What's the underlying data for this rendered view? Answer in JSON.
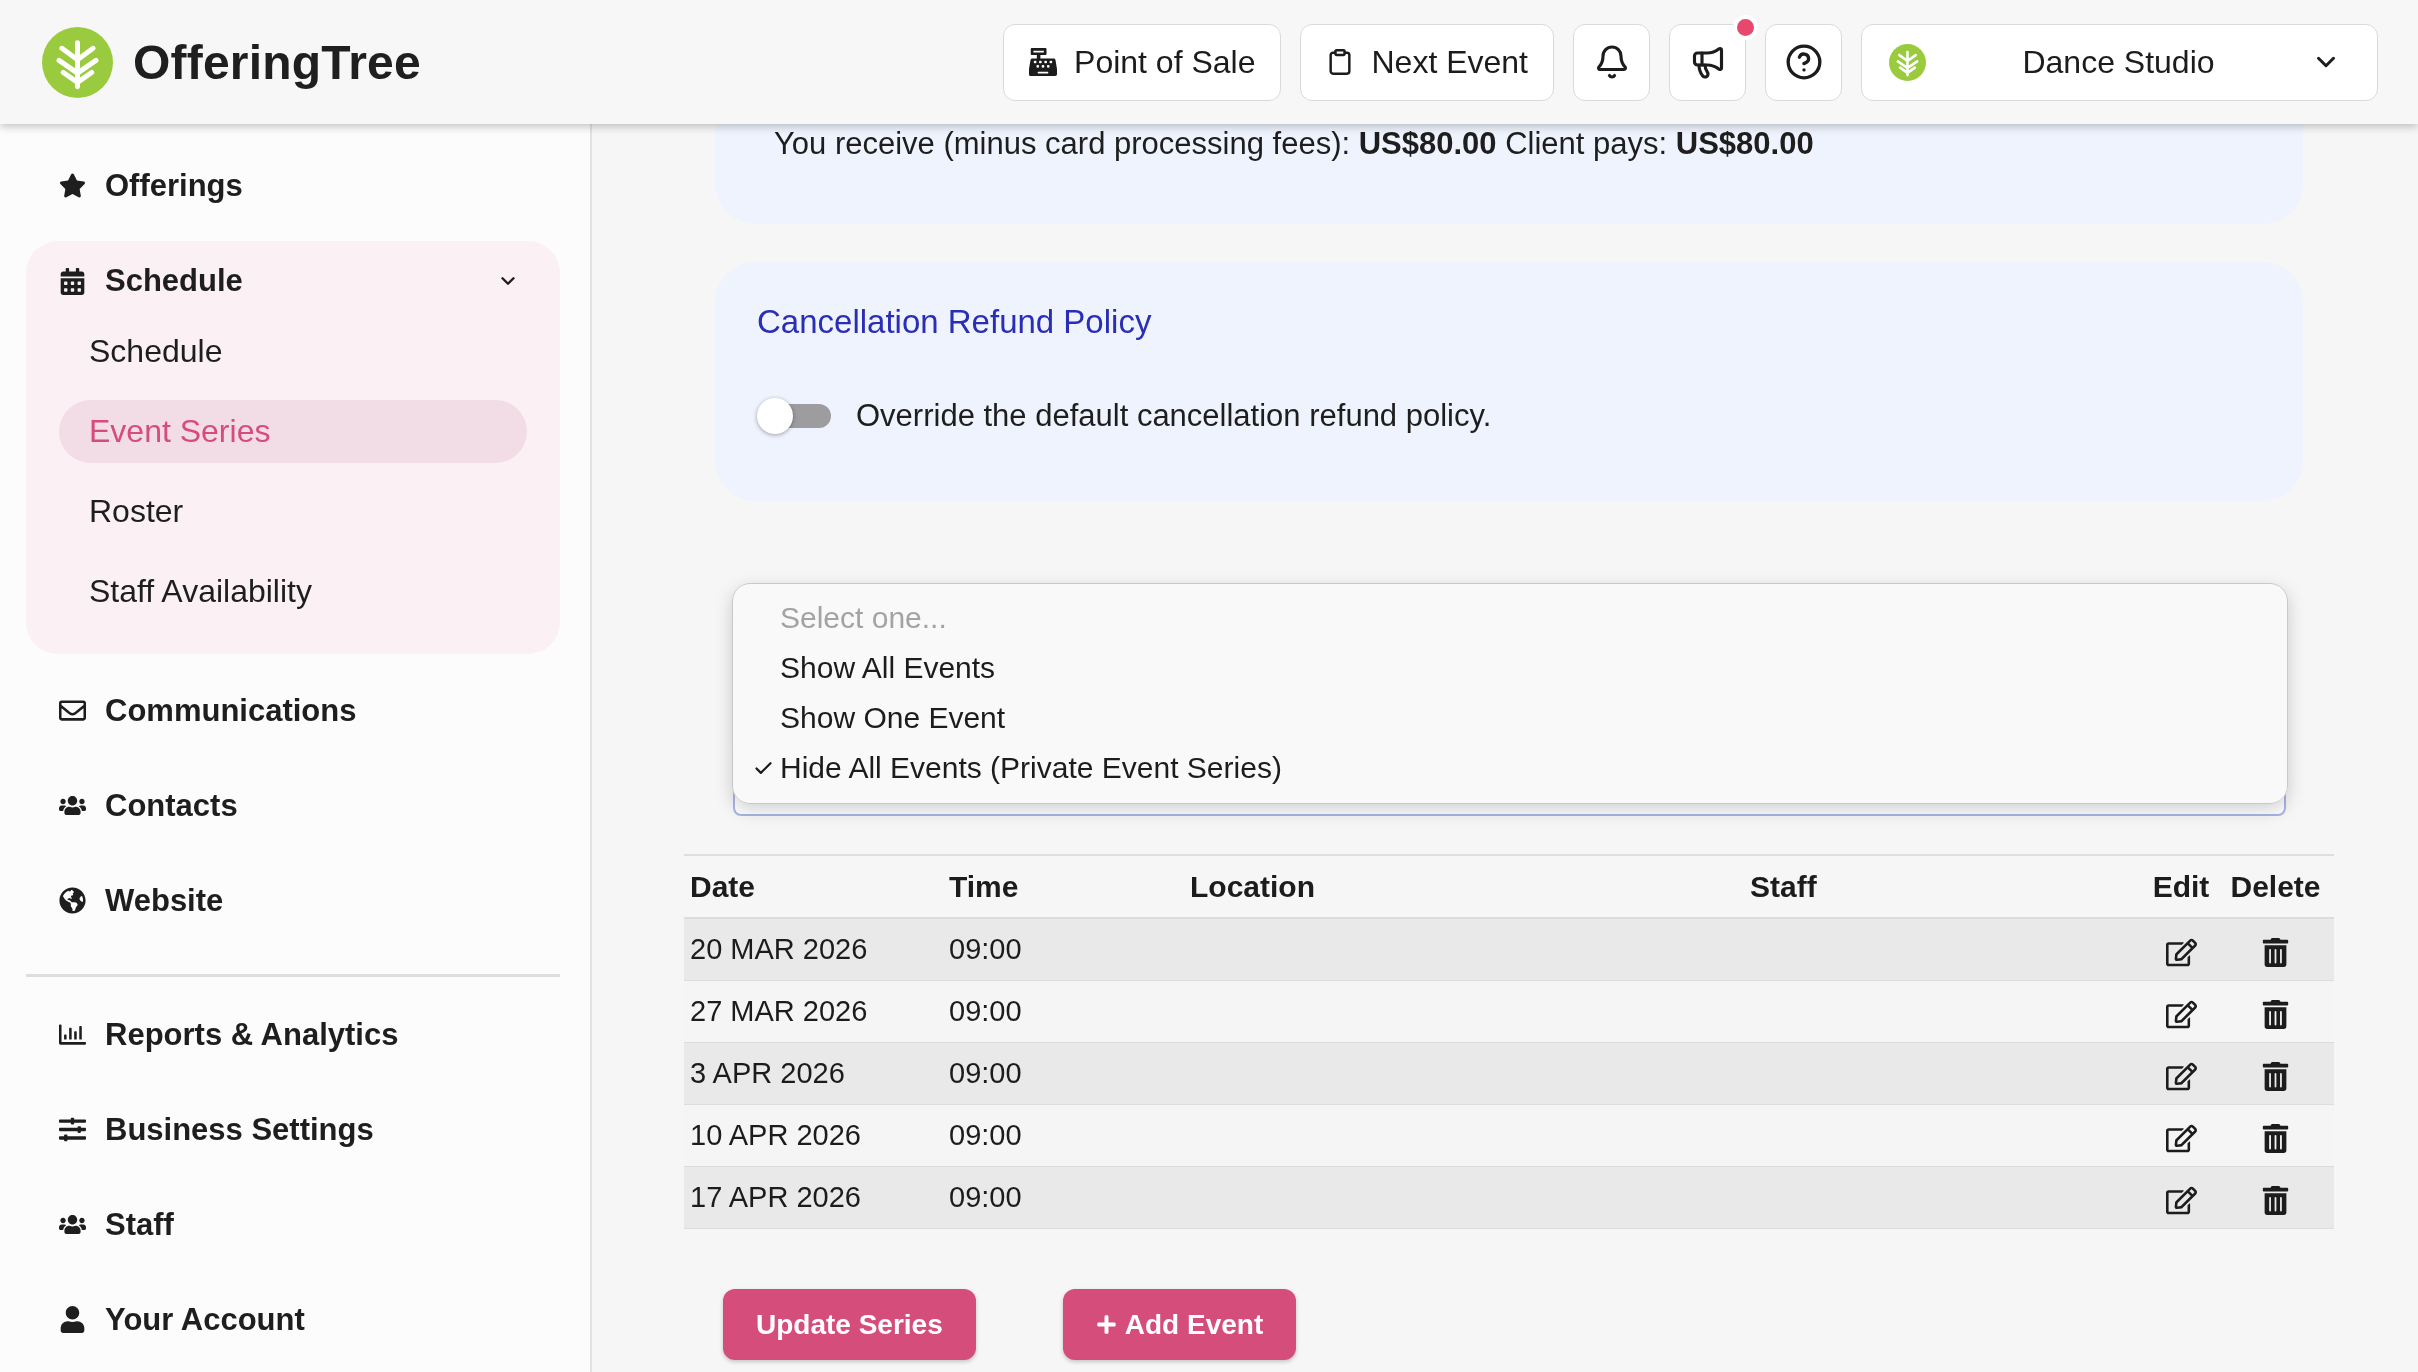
{
  "header": {
    "brand": "OfferingTree",
    "buttons": [
      {
        "kind": "pos",
        "label": "Point of Sale",
        "badge": false
      },
      {
        "kind": "next_event",
        "label": "Next Event",
        "badge": false
      },
      {
        "kind": "notifications",
        "badge": false
      },
      {
        "kind": "announcements",
        "badge": true
      },
      {
        "kind": "help",
        "badge": false
      }
    ],
    "business": {
      "name": "Dance Studio"
    }
  },
  "sidebar": {
    "sections": [
      {
        "items": [
          {
            "label": "Offerings",
            "selected": false
          },
          {
            "label": "Schedule",
            "selected": false,
            "expanded": true,
            "children": [
              {
                "label": "Schedule",
                "selected": false
              },
              {
                "label": "Event Series",
                "selected": true
              },
              {
                "label": "Roster",
                "selected": false
              },
              {
                "label": "Staff Availability",
                "selected": false
              }
            ]
          },
          {
            "label": "Communications",
            "selected": false
          },
          {
            "label": "Contacts",
            "selected": false
          },
          {
            "label": "Website",
            "selected": false
          }
        ]
      },
      {
        "items": [
          {
            "label": "Reports & Analytics",
            "selected": false
          },
          {
            "label": "Business Settings",
            "selected": false
          },
          {
            "label": "Staff",
            "selected": false
          },
          {
            "label": "Your Account",
            "selected": false
          }
        ]
      }
    ]
  },
  "fees": {
    "text": "You receive (minus card processing fees): **US$80.00** Client pays: **US$80.00**"
  },
  "refund_policy": {
    "title": "Cancellation Refund Policy",
    "override": {
      "label": "Override the default cancellation refund policy.",
      "on": false
    }
  },
  "visibility_select": {
    "expanded": true,
    "options": [
      {
        "label": "Select one...",
        "disabled": true,
        "selected": false
      },
      {
        "label": "Show All Events",
        "disabled": false,
        "selected": false
      },
      {
        "label": "Show One Event",
        "disabled": false,
        "selected": false
      },
      {
        "label": "Hide All Events (Private Event Series)",
        "disabled": false,
        "selected": true
      }
    ]
  },
  "events_table": {
    "columns": [
      "Date",
      "Time",
      "Location",
      "Staff",
      "Edit",
      "Delete"
    ],
    "rows": [
      {
        "date": "20 MAR 2026",
        "time": "09:00"
      },
      {
        "date": "27 MAR 2026",
        "time": "09:00"
      },
      {
        "date": "3 APR 2026",
        "time": "09:00"
      },
      {
        "date": "10 APR 2026",
        "time": "09:00"
      },
      {
        "date": "17 APR 2026",
        "time": "09:00"
      }
    ]
  },
  "actions": [
    {
      "kind": "update",
      "label": "Update Series"
    },
    {
      "kind": "add",
      "label": "Add Event"
    }
  ]
}
